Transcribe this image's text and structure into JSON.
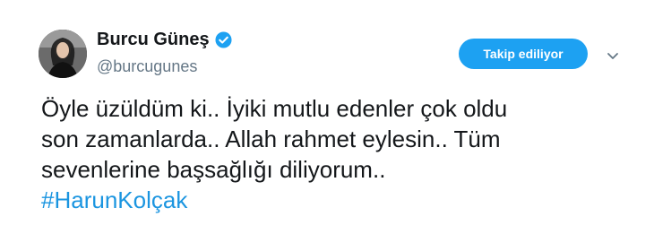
{
  "user": {
    "display_name": "Burcu Güneş",
    "handle": "@burcugunes",
    "verified": true
  },
  "follow_button": {
    "label": "Takip ediliyor"
  },
  "menu": {
    "icon": "chevron-down-icon"
  },
  "tweet": {
    "lines": [
      "Öyle üzüldüm ki.. İyiki mutlu edenler çok oldu",
      "son zamanlarda.. Allah rahmet eylesin.. Tüm",
      "sevenlerine başsağlığı diliyorum.."
    ],
    "hashtag": "#HarunKolçak"
  },
  "colors": {
    "accent": "#1da1f2",
    "hashtag": "#1b95e0",
    "handle": "#657786",
    "text": "#14171a"
  }
}
